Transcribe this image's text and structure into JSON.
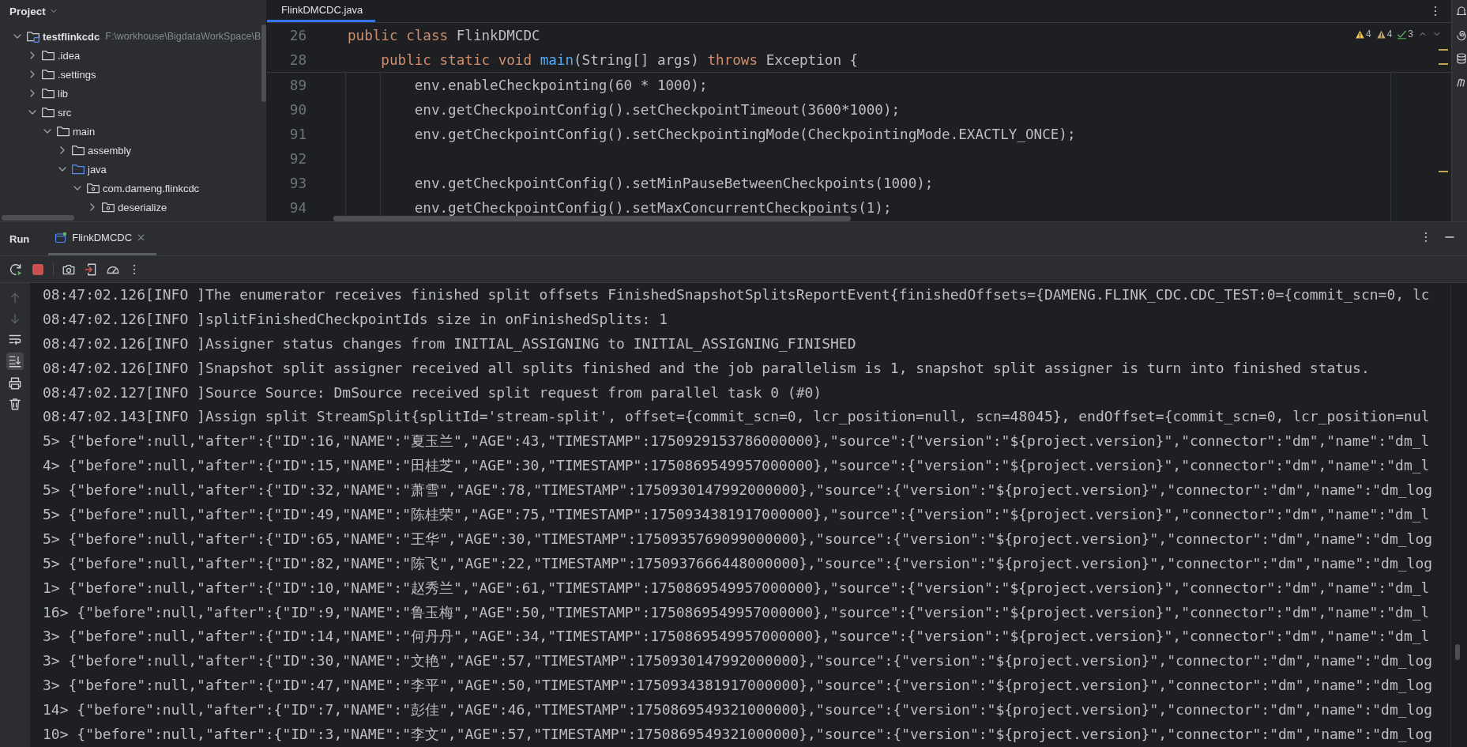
{
  "project_panel": {
    "title": "Project",
    "tree": [
      {
        "label": "testflinkcdc",
        "path": "F:\\workhouse\\BigdataWorkSpace\\B",
        "kind": "module",
        "expanded": true,
        "children": [
          {
            "label": ".idea",
            "kind": "folder",
            "expanded": false
          },
          {
            "label": ".settings",
            "kind": "folder",
            "expanded": false
          },
          {
            "label": "lib",
            "kind": "folder",
            "expanded": false
          },
          {
            "label": "src",
            "kind": "folder",
            "expanded": true,
            "children": [
              {
                "label": "main",
                "kind": "folder",
                "expanded": true,
                "children": [
                  {
                    "label": "assembly",
                    "kind": "folder",
                    "expanded": false
                  },
                  {
                    "label": "java",
                    "kind": "source",
                    "expanded": true,
                    "children": [
                      {
                        "label": "com.dameng.flinkcdc",
                        "kind": "package",
                        "expanded": true,
                        "children": [
                          {
                            "label": "deserialize",
                            "kind": "package",
                            "expanded": false
                          }
                        ]
                      }
                    ]
                  }
                ]
              }
            ]
          }
        ]
      }
    ]
  },
  "editor": {
    "tabs": [
      {
        "label": "FlinkDMCDC.java",
        "selected": true
      }
    ],
    "inspections": [
      {
        "kind": "warning",
        "count": "4"
      },
      {
        "kind": "weak-warning",
        "count": "4"
      },
      {
        "kind": "ok",
        "count": "3"
      }
    ],
    "sticky_lines": [
      {
        "number": "26",
        "tokens": [
          {
            "text": "public class ",
            "kind": "keyword"
          },
          {
            "text": "FlinkDMCDC",
            "kind": "plain"
          }
        ]
      },
      {
        "number": "28",
        "tokens": [
          {
            "text": "    public static void ",
            "kind": "keyword"
          },
          {
            "text": "main",
            "kind": "method"
          },
          {
            "text": "(String[] args) ",
            "kind": "plain"
          },
          {
            "text": "throws ",
            "kind": "keyword"
          },
          {
            "text": "Exception {",
            "kind": "plain"
          }
        ]
      }
    ],
    "lines": [
      {
        "number": "89",
        "tokens": [
          {
            "text": "        env.enableCheckpointing(60 * 1000);",
            "kind": "plain"
          }
        ]
      },
      {
        "number": "90",
        "tokens": [
          {
            "text": "        env.getCheckpointConfig().setCheckpointTimeout(3600*1000);",
            "kind": "plain"
          }
        ]
      },
      {
        "number": "91",
        "tokens": [
          {
            "text": "        env.getCheckpointConfig().setCheckpointingMode(CheckpointingMode.EXACTLY_ONCE);",
            "kind": "plain"
          }
        ]
      },
      {
        "number": "92"
      },
      {
        "number": "93",
        "tokens": [
          {
            "text": "        env.getCheckpointConfig().setMinPauseBetweenCheckpoints(1000);",
            "kind": "plain"
          }
        ]
      },
      {
        "number": "94",
        "tokens": [
          {
            "text": "        env.getCheckpointConfig().setMaxConcurrentCheckpoints(1);",
            "kind": "plain"
          }
        ]
      }
    ]
  },
  "run_panel": {
    "title": "Run",
    "tabs": [
      {
        "label": "FlinkDMCDC",
        "selected": true
      }
    ],
    "console": [
      "08:47:02.126[INFO ]The enumerator receives finished split offsets FinishedSnapshotSplitsReportEvent{finishedOffsets={DAMENG.FLINK_CDC.CDC_TEST:0={commit_scn=0, lc",
      "08:47:02.126[INFO ]splitFinishedCheckpointIds size in onFinishedSplits: 1",
      "08:47:02.126[INFO ]Assigner status changes from INITIAL_ASSIGNING to INITIAL_ASSIGNING_FINISHED",
      "08:47:02.126[INFO ]Snapshot split assigner received all splits finished and the job parallelism is 1, snapshot split assigner is turn into finished status.",
      "08:47:02.127[INFO ]Source Source: DmSource received split request from parallel task 0 (#0)",
      "08:47:02.143[INFO ]Assign split StreamSplit{splitId='stream-split', offset={commit_scn=0, lcr_position=null, scn=48045}, endOffset={commit_scn=0, lcr_position=nul",
      "5> {\"before\":null,\"after\":{\"ID\":16,\"NAME\":\"夏玉兰\",\"AGE\":43,\"TIMESTAMP\":1750929153786000000},\"source\":{\"version\":\"${project.version}\",\"connector\":\"dm\",\"name\":\"dm_l",
      "4> {\"before\":null,\"after\":{\"ID\":15,\"NAME\":\"田桂芝\",\"AGE\":30,\"TIMESTAMP\":1750869549957000000},\"source\":{\"version\":\"${project.version}\",\"connector\":\"dm\",\"name\":\"dm_l",
      "5> {\"before\":null,\"after\":{\"ID\":32,\"NAME\":\"萧雪\",\"AGE\":78,\"TIMESTAMP\":1750930147992000000},\"source\":{\"version\":\"${project.version}\",\"connector\":\"dm\",\"name\":\"dm_log",
      "5> {\"before\":null,\"after\":{\"ID\":49,\"NAME\":\"陈桂荣\",\"AGE\":75,\"TIMESTAMP\":1750934381917000000},\"source\":{\"version\":\"${project.version}\",\"connector\":\"dm\",\"name\":\"dm_l",
      "5> {\"before\":null,\"after\":{\"ID\":65,\"NAME\":\"王华\",\"AGE\":30,\"TIMESTAMP\":1750935769099000000},\"source\":{\"version\":\"${project.version}\",\"connector\":\"dm\",\"name\":\"dm_log",
      "5> {\"before\":null,\"after\":{\"ID\":82,\"NAME\":\"陈飞\",\"AGE\":22,\"TIMESTAMP\":1750937666448000000},\"source\":{\"version\":\"${project.version}\",\"connector\":\"dm\",\"name\":\"dm_log",
      "1> {\"before\":null,\"after\":{\"ID\":10,\"NAME\":\"赵秀兰\",\"AGE\":61,\"TIMESTAMP\":1750869549957000000},\"source\":{\"version\":\"${project.version}\",\"connector\":\"dm\",\"name\":\"dm_l",
      "16> {\"before\":null,\"after\":{\"ID\":9,\"NAME\":\"鲁玉梅\",\"AGE\":50,\"TIMESTAMP\":1750869549957000000},\"source\":{\"version\":\"${project.version}\",\"connector\":\"dm\",\"name\":\"dm_l",
      "3> {\"before\":null,\"after\":{\"ID\":14,\"NAME\":\"何丹丹\",\"AGE\":34,\"TIMESTAMP\":1750869549957000000},\"source\":{\"version\":\"${project.version}\",\"connector\":\"dm\",\"name\":\"dm_l",
      "3> {\"before\":null,\"after\":{\"ID\":30,\"NAME\":\"文艳\",\"AGE\":57,\"TIMESTAMP\":1750930147992000000},\"source\":{\"version\":\"${project.version}\",\"connector\":\"dm\",\"name\":\"dm_log",
      "3> {\"before\":null,\"after\":{\"ID\":47,\"NAME\":\"李平\",\"AGE\":50,\"TIMESTAMP\":1750934381917000000},\"source\":{\"version\":\"${project.version}\",\"connector\":\"dm\",\"name\":\"dm_log",
      "14> {\"before\":null,\"after\":{\"ID\":7,\"NAME\":\"彭佳\",\"AGE\":46,\"TIMESTAMP\":1750869549321000000},\"source\":{\"version\":\"${project.version}\",\"connector\":\"dm\",\"name\":\"dm_log",
      "10> {\"before\":null,\"after\":{\"ID\":3,\"NAME\":\"李文\",\"AGE\":57,\"TIMESTAMP\":1750869549321000000},\"source\":{\"version\":\"${project.version}\",\"connector\":\"dm\",\"name\":\"dm_log"
    ]
  }
}
